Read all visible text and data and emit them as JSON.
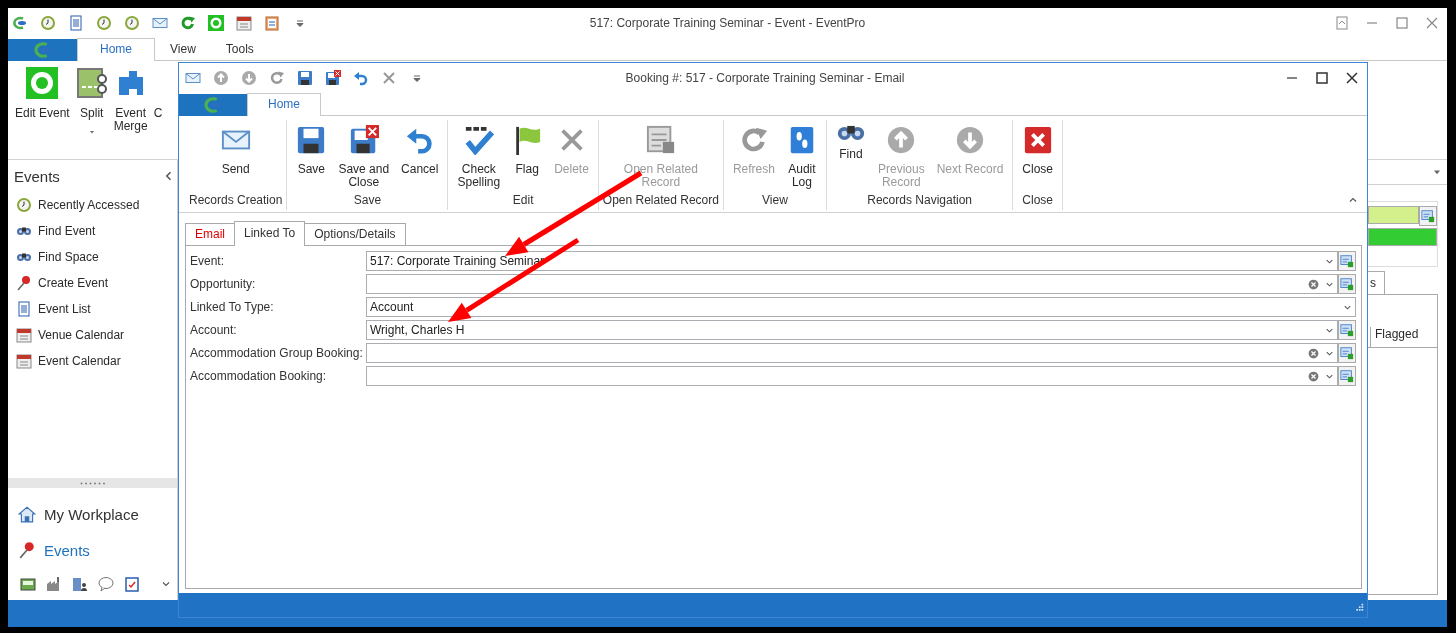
{
  "main_window": {
    "title": "517: Corporate Training Seminar - Event - EventPro",
    "ribbon_tabs": [
      {
        "label": "Home",
        "selected": true
      },
      {
        "label": "View",
        "selected": false
      },
      {
        "label": "Tools",
        "selected": false
      }
    ],
    "ribbon_buttons": [
      {
        "label": "Edit Event",
        "dropdown": false
      },
      {
        "label": "Split",
        "dropdown": true
      },
      {
        "label": "Event\nMerge",
        "dropdown": false
      },
      {
        "label": "C",
        "dropdown": false
      }
    ],
    "sidebar": {
      "title": "Events",
      "items": [
        {
          "label": "Recently Accessed"
        },
        {
          "label": "Find Event"
        },
        {
          "label": "Find Space"
        },
        {
          "label": "Create Event"
        },
        {
          "label": "Event List"
        },
        {
          "label": "Venue Calendar"
        },
        {
          "label": "Event Calendar"
        }
      ],
      "nav": [
        {
          "label": "My Workplace",
          "selected": false
        },
        {
          "label": "Events",
          "selected": true
        }
      ]
    },
    "side_panel": {
      "tab_label": "s",
      "column_header": "Flagged"
    }
  },
  "dialog": {
    "title": "Booking #: 517 - Corporate Training Seminar - Email",
    "ribbon_tabs": [
      {
        "label": "Home",
        "selected": true
      }
    ],
    "groups": [
      {
        "label": "Records Creation",
        "buttons": [
          {
            "label": "Send",
            "disabled": false
          }
        ]
      },
      {
        "label": "Save",
        "buttons": [
          {
            "label": "Save",
            "disabled": false
          },
          {
            "label": "Save and\nClose",
            "disabled": false
          },
          {
            "label": "Cancel",
            "disabled": false
          }
        ]
      },
      {
        "label": "Edit",
        "buttons": [
          {
            "label": "Check\nSpelling",
            "disabled": false
          },
          {
            "label": "Flag",
            "disabled": false
          },
          {
            "label": "Delete",
            "disabled": true
          }
        ]
      },
      {
        "label": "Open Related Record",
        "buttons": [
          {
            "label": "Open Related\nRecord",
            "disabled": true
          }
        ]
      },
      {
        "label": "View",
        "buttons": [
          {
            "label": "Refresh",
            "disabled": true
          },
          {
            "label": "Audit\nLog",
            "disabled": false
          }
        ]
      },
      {
        "label": "Records Navigation",
        "buttons": [
          {
            "label": "Find",
            "disabled": false
          },
          {
            "label": "Previous\nRecord",
            "disabled": true
          },
          {
            "label": "Next Record",
            "disabled": true
          }
        ]
      },
      {
        "label": "Close",
        "buttons": [
          {
            "label": "Close",
            "disabled": false
          }
        ]
      }
    ],
    "tabs": [
      {
        "label": "Email",
        "selected": false,
        "error": true
      },
      {
        "label": "Linked To",
        "selected": true,
        "error": false
      },
      {
        "label": "Options/Details",
        "selected": false,
        "error": false
      }
    ],
    "fields": [
      {
        "label": "Event:",
        "value": "517: Corporate Training Seminar",
        "clearable": false,
        "lookup": true
      },
      {
        "label": "Opportunity:",
        "clearable": true,
        "lookup": true
      },
      {
        "label": "Linked To Type:",
        "value": "Account",
        "clearable": false,
        "lookup": false
      },
      {
        "label": "Account:",
        "value": "Wright, Charles H",
        "clearable": false,
        "lookup": true
      },
      {
        "label": "Accommodation Group Booking:",
        "clearable": true,
        "lookup": true
      },
      {
        "label": "Accommodation Booking:",
        "clearable": true,
        "lookup": true
      }
    ]
  }
}
